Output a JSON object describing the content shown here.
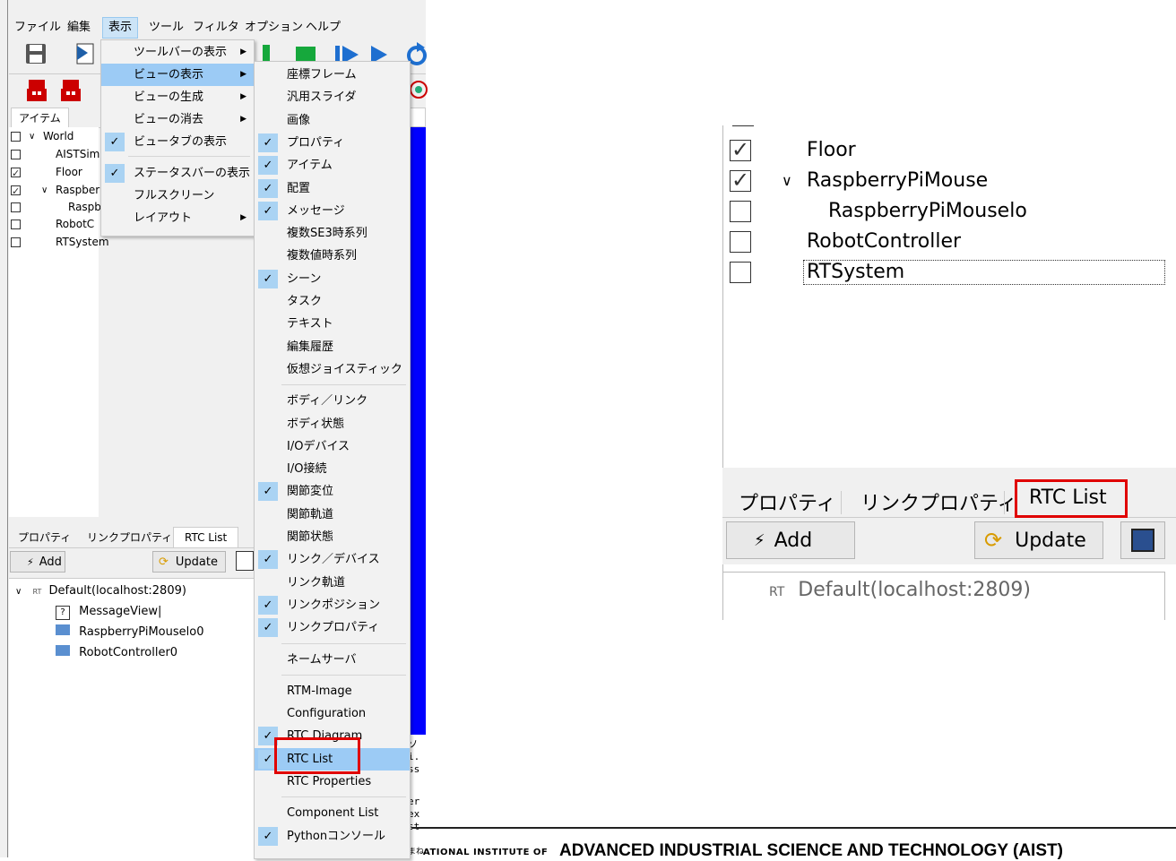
{
  "menubar": [
    "ファイル",
    "編集",
    "表示",
    "ツール",
    "フィルタ",
    "オプション",
    "ヘルプ"
  ],
  "left_tabs": {
    "items": "アイテム"
  },
  "tree": [
    {
      "label": "World",
      "checked": false,
      "expand": "∨"
    },
    {
      "label": "AISTSim",
      "checked": false
    },
    {
      "label": "Floor",
      "checked": true
    },
    {
      "label": "Raspber",
      "checked": true,
      "expand": "∨"
    },
    {
      "label": "Raspb",
      "checked": false
    },
    {
      "label": "RobotC",
      "checked": false
    },
    {
      "label": "RTSystem",
      "checked": false
    }
  ],
  "view_menu": [
    {
      "label": "ツールバーの表示",
      "arrow": true,
      "checked": false
    },
    {
      "label": "ビューの表示",
      "arrow": true,
      "checked": false,
      "highlight": true
    },
    {
      "label": "ビューの生成",
      "arrow": true,
      "checked": false
    },
    {
      "label": "ビューの消去",
      "arrow": true,
      "checked": false
    },
    {
      "label": "ビュータブの表示",
      "arrow": false,
      "checked": true
    },
    {
      "label": "ステータスバーの表示",
      "arrow": false,
      "checked": true
    },
    {
      "label": "フルスクリーン",
      "arrow": false,
      "checked": false
    },
    {
      "label": "レイアウト",
      "arrow": true,
      "checked": false
    }
  ],
  "submenu": [
    {
      "label": "座標フレーム",
      "checked": false
    },
    {
      "label": "汎用スライダ",
      "checked": false
    },
    {
      "label": "画像",
      "checked": false
    },
    {
      "label": "プロパティ",
      "checked": true
    },
    {
      "label": "アイテム",
      "checked": true
    },
    {
      "label": "配置",
      "checked": true
    },
    {
      "label": "メッセージ",
      "checked": true
    },
    {
      "label": "複数SE3時系列",
      "checked": false
    },
    {
      "label": "複数値時系列",
      "checked": false
    },
    {
      "label": "シーン",
      "checked": true
    },
    {
      "label": "タスク",
      "checked": false
    },
    {
      "label": "テキスト",
      "checked": false
    },
    {
      "label": "編集履歴",
      "checked": false
    },
    {
      "label": "仮想ジョイスティック",
      "checked": false
    },
    {
      "label": "ボディ／リンク",
      "checked": false
    },
    {
      "label": "ボディ状態",
      "checked": false
    },
    {
      "label": "I/Oデバイス",
      "checked": false
    },
    {
      "label": "I/O接続",
      "checked": false
    },
    {
      "label": "関節変位",
      "checked": true
    },
    {
      "label": "関節軌道",
      "checked": false
    },
    {
      "label": "関節状態",
      "checked": false
    },
    {
      "label": "リンク／デバイス",
      "checked": true
    },
    {
      "label": "リンク軌道",
      "checked": false
    },
    {
      "label": "リンクポジション",
      "checked": true
    },
    {
      "label": "リンクプロパティ",
      "checked": true
    },
    {
      "label": "ネームサーバ",
      "checked": false
    },
    {
      "label": "RTM-Image",
      "checked": false
    },
    {
      "label": "Configuration",
      "checked": false
    },
    {
      "label": "RTC Diagram",
      "checked": true
    },
    {
      "label": "RTC List",
      "checked": true,
      "highlight": true
    },
    {
      "label": "RTC Properties",
      "checked": false
    },
    {
      "label": "Component List",
      "checked": false
    },
    {
      "label": "Pythonコンソール",
      "checked": true
    }
  ],
  "bottom_tabs": [
    "プロパティ",
    "リンクプロパティ",
    "RTC List"
  ],
  "buttons": {
    "add": "Add",
    "update": "Update"
  },
  "rtc_tree": {
    "root_prefix": "RT",
    "root": "Default(localhost:2809)",
    "children": [
      "MessageView|",
      "RaspberryPiMouselo0",
      "RobotController0"
    ]
  },
  "console_fragments": [
    "ソ",
    "i.",
    "ss",
    "er",
    "ex",
    "st",
    "まね"
  ],
  "zoom": {
    "tree": [
      {
        "label": "Floor",
        "checked": true,
        "indent": 0
      },
      {
        "label": "RaspberryPiMouse",
        "checked": true,
        "indent": 0,
        "expand": "∨"
      },
      {
        "label": "RaspberryPiMouselo",
        "checked": false,
        "indent": 1
      },
      {
        "label": "RobotController",
        "checked": false,
        "indent": 0
      },
      {
        "label": "RTSystem",
        "checked": false,
        "indent": 0
      }
    ],
    "tabs": [
      "プロパティ",
      "リンクプロパティ",
      "RTC List"
    ],
    "add": "Add",
    "update": "Update",
    "root_prefix": "RT",
    "root": "Default(localhost:2809)"
  },
  "footer": {
    "prefix": "ATIONAL INSTITUTE OF",
    "main": "ADVANCED INDUSTRIAL SCIENCE AND TECHNOLOGY (AIST)"
  },
  "colors": {
    "highlight": "#9ccbf5",
    "check_bg": "#aad3f3",
    "scene_blue": "#0000ff",
    "callout_red": "#e00000"
  }
}
